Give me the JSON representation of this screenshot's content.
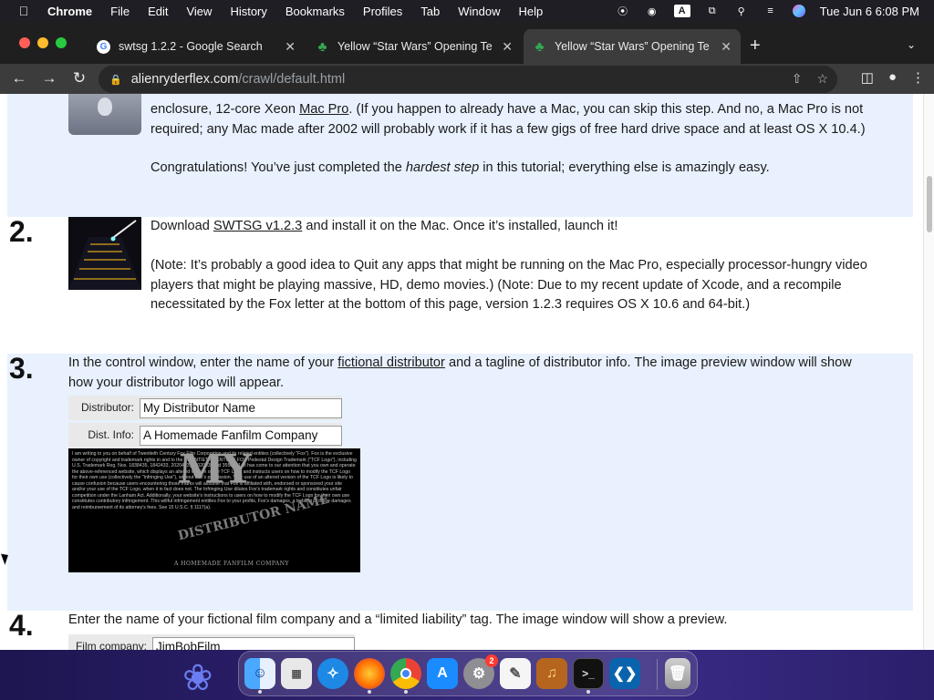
{
  "menubar": {
    "app": "Chrome",
    "items": [
      "File",
      "Edit",
      "View",
      "History",
      "Bookmarks",
      "Profiles",
      "Tab",
      "Window",
      "Help"
    ],
    "input_badge": "A",
    "clock": "Tue Jun 6  6:08 PM"
  },
  "tabs": [
    {
      "title": "swtsg 1.2.2 - Google Search",
      "icon": "google-icon",
      "active": false
    },
    {
      "title": "Yellow “Star Wars” Opening Te",
      "icon": "clover-icon",
      "active": false
    },
    {
      "title": "Yellow “Star Wars” Opening Te",
      "icon": "clover-icon",
      "active": true
    }
  ],
  "address": {
    "host": "alienryderflex.com",
    "path": "/crawl/default.html"
  },
  "page": {
    "step1": {
      "line1_pre": "enclosure, 12-core Xeon ",
      "line1_link": "Mac Pro",
      "line1_post": ". (If you happen to already have a Mac, you can skip this step. And no, a Mac Pro is not",
      "line2": "required; any Mac made after 2002 will probably work if it has a few gigs of free hard drive space and at least OS X 10.4.)",
      "congrats_pre": "Congratulations! You’ve just completed the ",
      "congrats_em": "hardest step",
      "congrats_post": " in this tutorial; everything else is amazingly easy."
    },
    "step2": {
      "num": "2.",
      "p1_pre": "Download ",
      "p1_link": "SWTSG v1.2.3",
      "p1_post": " and install it on the Mac. Once it’s installed, launch it!",
      "p2_l1": "(Note: It’s probably a good idea to Quit any apps that might be running on the Mac Pro, especially processor-hungry video",
      "p2_l2": "players that might be playing massive, HD, demo movies.) (Note: Due to my recent update of Xcode, and a recompile",
      "p2_l3": "necessitated by the Fox letter at the bottom of this page, version 1.2.3 requires OS X 10.6 and 64-bit.)"
    },
    "step3": {
      "num": "3.",
      "l1_pre": "In the control window, enter the name of your ",
      "l1_link": "fictional distributor",
      "l1_post": " and a tagline of distributor info. The image preview window will show",
      "l2": "how your distributor logo will appear.",
      "distributor_label": "Distributor:",
      "distributor_value": "My Distributor Name",
      "distinfo_label": "Dist. Info:",
      "distinfo_value": "A Homemade Fanfilm Company",
      "preview_letter": "I am writing to you on behalf of Twentieth Century Fox Film Corporation and its related entities (collectively \"Fox\"). Fox is the exclusive owner of copyright and trademark rights in and to the TWENTIETH CENTURY FOX Pedestal Design Trademark (\"TCF Logo\"), including U.S. Trademark Reg. Nos. 1838435, 1842433, 2020413, 3002003, and 3550261. It has come to our attention that you own and operate the above-referenced website, which displays an altered version of the TCF Logo and instructs users on how to modify the TCF Logo for their own use (collectively the \"Infringing Use\"), without Fox's permission. Your use of an altered version of the TCF Logo is likely to cause confusion because users encountering those marks will assume that Fox is affiliated with, endorsed or sponsored your site and/or your use of the TCF Logo, when it in fact does not. The Infringing Use dilutes Fox's trademark rights and constitutes unfair competition under the Lanham Act. Additionally, your website's instructions to users on how to modify the TCF Logo for their own use constitutes contributory infringement. This willful infringement entitles Fox to your profits, Fox's damages, a trebling of those damages and reimbursement of its attorney's fees. See 15 U.S.C. § 1117(a).",
      "preview_logo_big": "MY",
      "preview_logo_sub": "DISTRIBUTOR NAME",
      "preview_logo_dist": "A HOMEMADE FANFILM COMPANY"
    },
    "step4": {
      "num": "4.",
      "l1": "Enter the name of your fictional film company and a “limited liability” tag. The image window will show a preview.",
      "film_label": "Film company:",
      "film_value": "JimBobFilm"
    }
  },
  "dock": {
    "apps": [
      "Finder",
      "Launchpad",
      "Safari",
      "Firefox",
      "Chrome",
      "App Store",
      "System Settings",
      "TextEdit",
      "Instruments",
      "Terminal",
      "VS Code"
    ],
    "settings_badge": "2"
  }
}
